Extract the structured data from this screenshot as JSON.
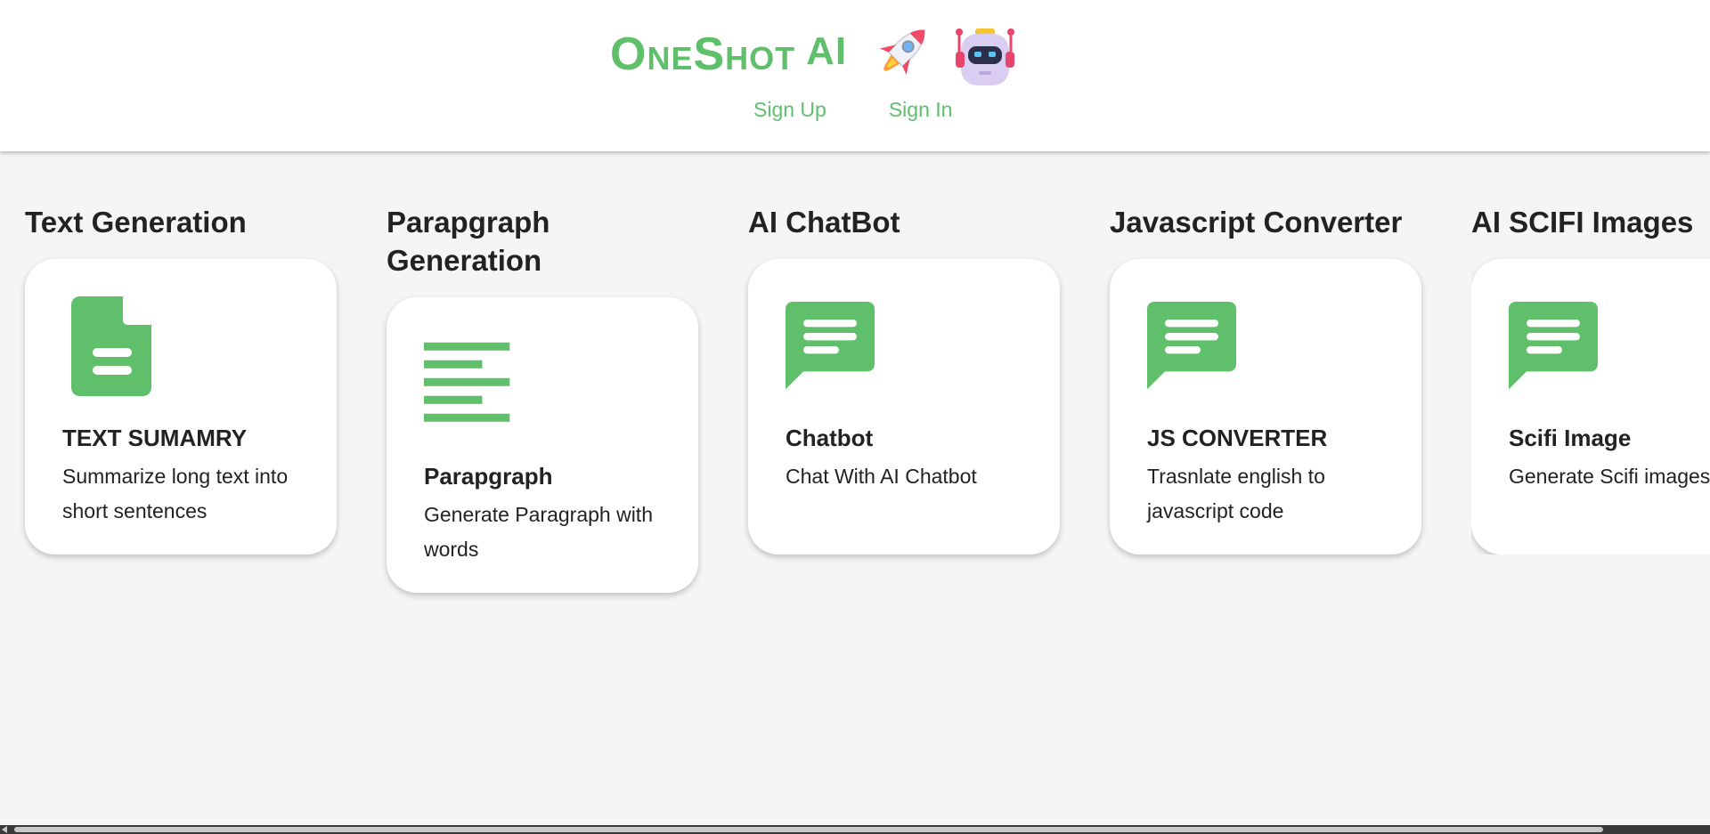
{
  "header": {
    "logo_main": "OneShot",
    "logo_ai": "AI",
    "sign_up": "Sign Up",
    "sign_in": "Sign In"
  },
  "colors": {
    "brand_green": "#5fbf6b",
    "background": "#f5f5f5",
    "card": "#ffffff",
    "text": "#222222"
  },
  "categories": [
    {
      "heading": "Text Generation",
      "card_title": "TEXT SUMAMRY",
      "card_desc": "Summarize long text into short sentences",
      "icon": "document-icon"
    },
    {
      "heading": "Parapgraph Generation",
      "card_title": "Parapgraph",
      "card_desc": "Generate Paragraph with words",
      "icon": "paragraph-icon"
    },
    {
      "heading": "AI ChatBot",
      "card_title": "Chatbot",
      "card_desc": "Chat With AI Chatbot",
      "icon": "chat-icon"
    },
    {
      "heading": "Javascript Converter",
      "card_title": "JS CONVERTER",
      "card_desc": "Trasnlate english to javascript code",
      "icon": "chat-icon"
    },
    {
      "heading": "AI SCIFI Images",
      "card_title": "Scifi Image",
      "card_desc": "Generate Scifi images",
      "icon": "chat-icon"
    }
  ]
}
